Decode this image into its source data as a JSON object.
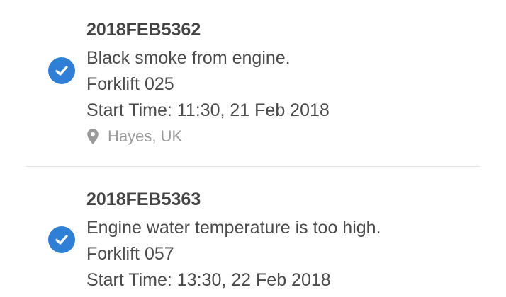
{
  "tickets": [
    {
      "id": "2018FEB5362",
      "description": "Black smoke from engine.",
      "asset": "Forklift 025",
      "start_time": "Start Time: 11:30, 21 Feb 2018",
      "location": "Hayes, UK"
    },
    {
      "id": "2018FEB5363",
      "description": "Engine water temperature is too high.",
      "asset": "Forklift 057",
      "start_time": "Start Time: 13:30, 22 Feb 2018"
    }
  ],
  "colors": {
    "check_blue": "#2f7fd6",
    "title_text": "#444444",
    "body_text": "#4b4b4b",
    "muted_text": "#9a9a9a",
    "divider": "#e0e0e0"
  },
  "icons": {
    "status": "check-circle-icon",
    "location": "map-pin-icon"
  }
}
